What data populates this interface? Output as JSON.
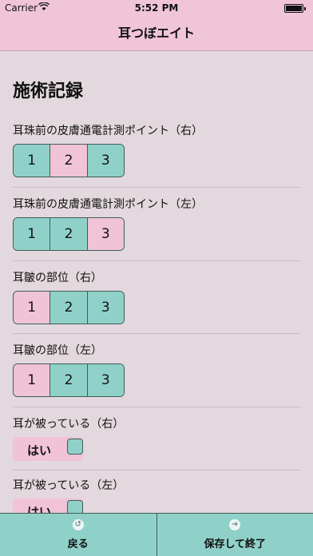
{
  "status_bar": {
    "carrier": "Carrier",
    "wifi": "wifi-icon",
    "time": "5:52 PM",
    "battery": "battery-icon"
  },
  "nav": {
    "title": "耳つぼエイト"
  },
  "section_title": "施術記録",
  "items": [
    {
      "label": "耳珠前の皮膚通電計測ポイント（右）",
      "options": [
        "1",
        "2",
        "3"
      ],
      "selected": "2"
    },
    {
      "label": "耳珠前の皮膚通電計測ポイント（左）",
      "options": [
        "1",
        "2",
        "3"
      ],
      "selected": "3"
    },
    {
      "label": "耳皺の部位（右）",
      "options": [
        "1",
        "2",
        "3"
      ],
      "selected": "1"
    },
    {
      "label": "耳皺の部位（左）",
      "options": [
        "1",
        "2",
        "3"
      ],
      "selected": "1"
    }
  ],
  "toggles": [
    {
      "label": "耳が被っている（右）",
      "value_label": "はい"
    },
    {
      "label": "耳が被っている（左）",
      "value_label": "はい"
    }
  ],
  "bottom": {
    "back_label": "戻る",
    "back_icon": "back-arrow-icon",
    "save_label": "保存して終了",
    "save_icon": "forward-arrow-icon"
  },
  "colors": {
    "pink": "#f0c3d6",
    "teal": "#8fd1c8",
    "background": "#e2d8dd"
  }
}
